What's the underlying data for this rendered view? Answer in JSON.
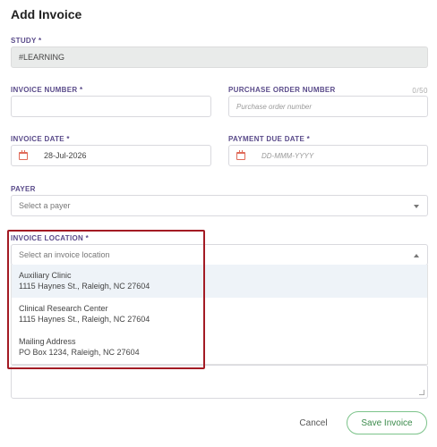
{
  "dialog": {
    "title": "Add Invoice"
  },
  "study": {
    "label": "STUDY *",
    "value": "#LEARNING"
  },
  "invoice_number": {
    "label": "INVOICE NUMBER *",
    "value": ""
  },
  "purchase_order": {
    "label": "PURCHASE ORDER NUMBER",
    "placeholder": "Purchase order number",
    "counter": "0/50"
  },
  "invoice_date": {
    "label": "INVOICE DATE *",
    "value": "28-Jul-2026",
    "icon": "calendar-icon"
  },
  "payment_due_date": {
    "label": "PAYMENT DUE DATE *",
    "placeholder": "DD-MMM-YYYY",
    "icon": "calendar-icon"
  },
  "payer": {
    "label": "PAYER",
    "placeholder": "Select a payer"
  },
  "invoice_location": {
    "label": "INVOICE LOCATION *",
    "placeholder": "Select an invoice location",
    "options": [
      {
        "name": "Auxiliary Clinic",
        "address": "1115 Haynes St., Raleigh, NC 27604"
      },
      {
        "name": "Clinical Research Center",
        "address": "1115 Haynes St., Raleigh, NC 27604"
      },
      {
        "name": "Mailing Address",
        "address": "PO Box 1234, Raleigh, NC 27604"
      }
    ]
  },
  "buttons": {
    "cancel": "Cancel",
    "save": "Save Invoice"
  },
  "colors": {
    "accent_label": "#5a4b8a",
    "save_green": "#3a8a4a",
    "highlight_red": "#a31b24",
    "calendar_icon": "#e06b5a"
  }
}
